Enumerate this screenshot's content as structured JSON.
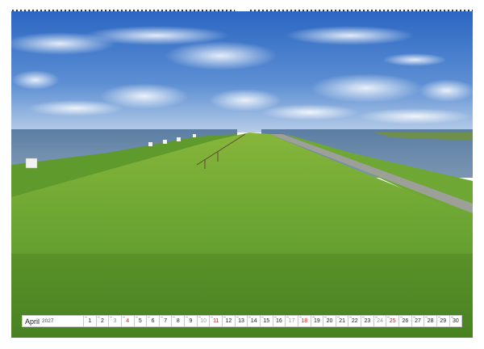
{
  "calendar": {
    "month": "April",
    "year": "2027",
    "days": [
      {
        "n": "1",
        "t": "w"
      },
      {
        "n": "2",
        "t": "w"
      },
      {
        "n": "3",
        "t": "sat"
      },
      {
        "n": "4",
        "t": "sun"
      },
      {
        "n": "5",
        "t": "w"
      },
      {
        "n": "6",
        "t": "w"
      },
      {
        "n": "7",
        "t": "w"
      },
      {
        "n": "8",
        "t": "w"
      },
      {
        "n": "9",
        "t": "w"
      },
      {
        "n": "10",
        "t": "sat"
      },
      {
        "n": "11",
        "t": "sun"
      },
      {
        "n": "12",
        "t": "w"
      },
      {
        "n": "13",
        "t": "w"
      },
      {
        "n": "14",
        "t": "w"
      },
      {
        "n": "15",
        "t": "w"
      },
      {
        "n": "16",
        "t": "w"
      },
      {
        "n": "17",
        "t": "sat"
      },
      {
        "n": "18",
        "t": "sun"
      },
      {
        "n": "19",
        "t": "w"
      },
      {
        "n": "20",
        "t": "w"
      },
      {
        "n": "21",
        "t": "w"
      },
      {
        "n": "22",
        "t": "w"
      },
      {
        "n": "23",
        "t": "w"
      },
      {
        "n": "24",
        "t": "sat"
      },
      {
        "n": "25",
        "t": "sun"
      },
      {
        "n": "26",
        "t": "w"
      },
      {
        "n": "27",
        "t": "w"
      },
      {
        "n": "28",
        "t": "w"
      },
      {
        "n": "29",
        "t": "w"
      },
      {
        "n": "30",
        "t": "w"
      }
    ]
  },
  "colors": {
    "sky_top": "#2f6fc7",
    "sky_bottom": "#a9c4e6",
    "water": "#6d8aa8",
    "grass_near": "#5d9a2c",
    "grass_far": "#8fbc3e",
    "sunday_red": "#d11a1a"
  }
}
